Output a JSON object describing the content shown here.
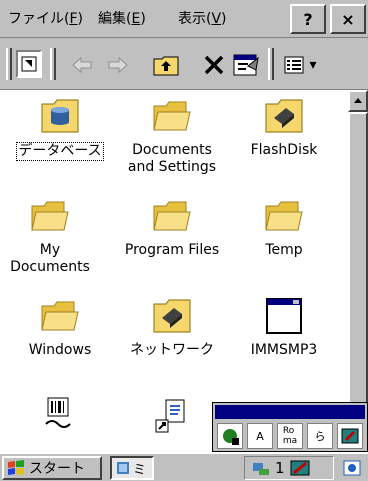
{
  "menu": {
    "file": "ファイル(F)",
    "file_prefix": "ファイル(",
    "file_key": "F",
    "edit_prefix": "編集(",
    "edit_key": "E",
    "view_prefix": "表示(",
    "view_key": "V",
    "close_paren": ")",
    "help_label": "?",
    "close_label": "×"
  },
  "toolbar": {
    "dropdown_arrow": "▾"
  },
  "icons": [
    {
      "label": "データベース",
      "icon": "database-icon"
    },
    {
      "label": "Documents\nand Settings",
      "icon": "folder-icon"
    },
    {
      "label": "FlashDisk",
      "icon": "flashdisk-icon"
    },
    {
      "label": "My\nDocuments",
      "icon": "folder-icon"
    },
    {
      "label": "Program Files",
      "icon": "folder-icon"
    },
    {
      "label": "Temp",
      "icon": "folder-icon"
    },
    {
      "label": "Windows",
      "icon": "folder-icon"
    },
    {
      "label": "ネットワーク",
      "icon": "network-icon"
    },
    {
      "label": "IMMSMP3",
      "icon": "application-icon"
    }
  ],
  "sip": {
    "items": [
      "",
      "A",
      "Ro\nma",
      "ら",
      ""
    ]
  },
  "taskbar": {
    "start_label": "スタート",
    "task_label": "ミ",
    "tray_count": "1"
  },
  "colors": {
    "chrome": "#c0c0c0",
    "titlebar_blue": "#000080",
    "folder_yellow": "#f5d76e"
  }
}
